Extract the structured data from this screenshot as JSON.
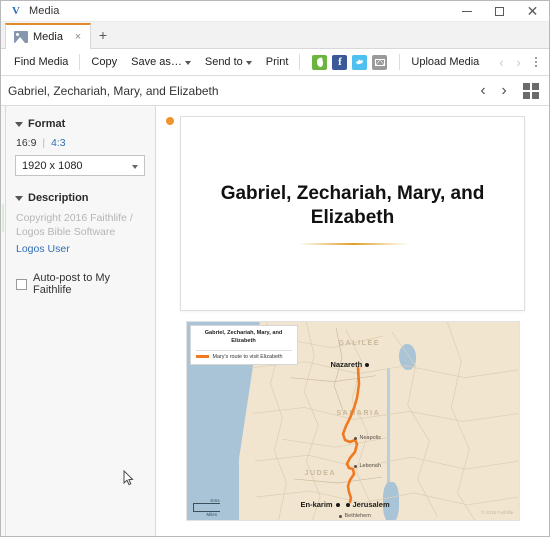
{
  "window": {
    "title": "Media",
    "logo_icon": "verbum-v-logo-icon",
    "controls": {
      "minimize": "minimize-icon",
      "maximize": "maximize-icon",
      "close": "close-icon"
    }
  },
  "tabs": {
    "items": [
      {
        "label": "Media",
        "icon": "image-tab-icon",
        "close": "×",
        "active": true
      }
    ],
    "new_tab": "+"
  },
  "toolbar": {
    "find_media": "Find Media",
    "copy": "Copy",
    "save_as": "Save as…",
    "send_to": "Send to",
    "print": "Print",
    "upload_media": "Upload Media",
    "social": [
      {
        "name": "faithlife-share-icon",
        "color": "#6bb43f"
      },
      {
        "name": "facebook-share-icon",
        "color": "#3b5998",
        "glyph": "f"
      },
      {
        "name": "twitter-share-icon",
        "color": "#4fc0f0"
      },
      {
        "name": "email-share-icon",
        "color": "#9a9a9a"
      }
    ],
    "prev": "‹",
    "next": "›",
    "overflow": "kebab-menu-icon"
  },
  "header": {
    "title": "Gabriel, Zechariah, Mary, and Elizabeth",
    "prev": "‹",
    "next": "›",
    "grid_view": "grid-view-icon"
  },
  "sidebar": {
    "format": {
      "heading": "Format",
      "ratio_selected": "16:9",
      "ratio_divider": "|",
      "ratio_alt": "4:3",
      "resolution": "1920 x 1080"
    },
    "description": {
      "heading": "Description",
      "copyright": "Copyright 2016 Faithlife / Logos Bible Software",
      "user": "Logos User"
    },
    "autopost": {
      "label": "Auto-post to My Faithlife",
      "checked": false
    }
  },
  "content": {
    "marker": "unsaved-change-dot",
    "slide": {
      "title": "Gabriel, Zechariah, Mary, and Elizabeth",
      "accent_color": "#e0a028"
    },
    "map": {
      "legend_title": "Gabriel, Zechariah, Mary, and Elizabeth",
      "legend_route": "Mary's route to visit Elizabeth",
      "route_color": "#ef7a21",
      "regions": [
        "GALILEE",
        "SAMARIA",
        "JUDEA"
      ],
      "cities": [
        {
          "name": "Nazareth",
          "size": "large"
        },
        {
          "name": "Neapolis",
          "size": "small"
        },
        {
          "name": "Lebonah",
          "size": "small"
        },
        {
          "name": "En-karim",
          "size": "large"
        },
        {
          "name": "Jerusalem",
          "size": "large"
        },
        {
          "name": "Bethlehem",
          "size": "small"
        }
      ],
      "scale_top": "Kms",
      "scale_bottom": "Miles",
      "credit": "© 2016 Faithlife"
    }
  }
}
